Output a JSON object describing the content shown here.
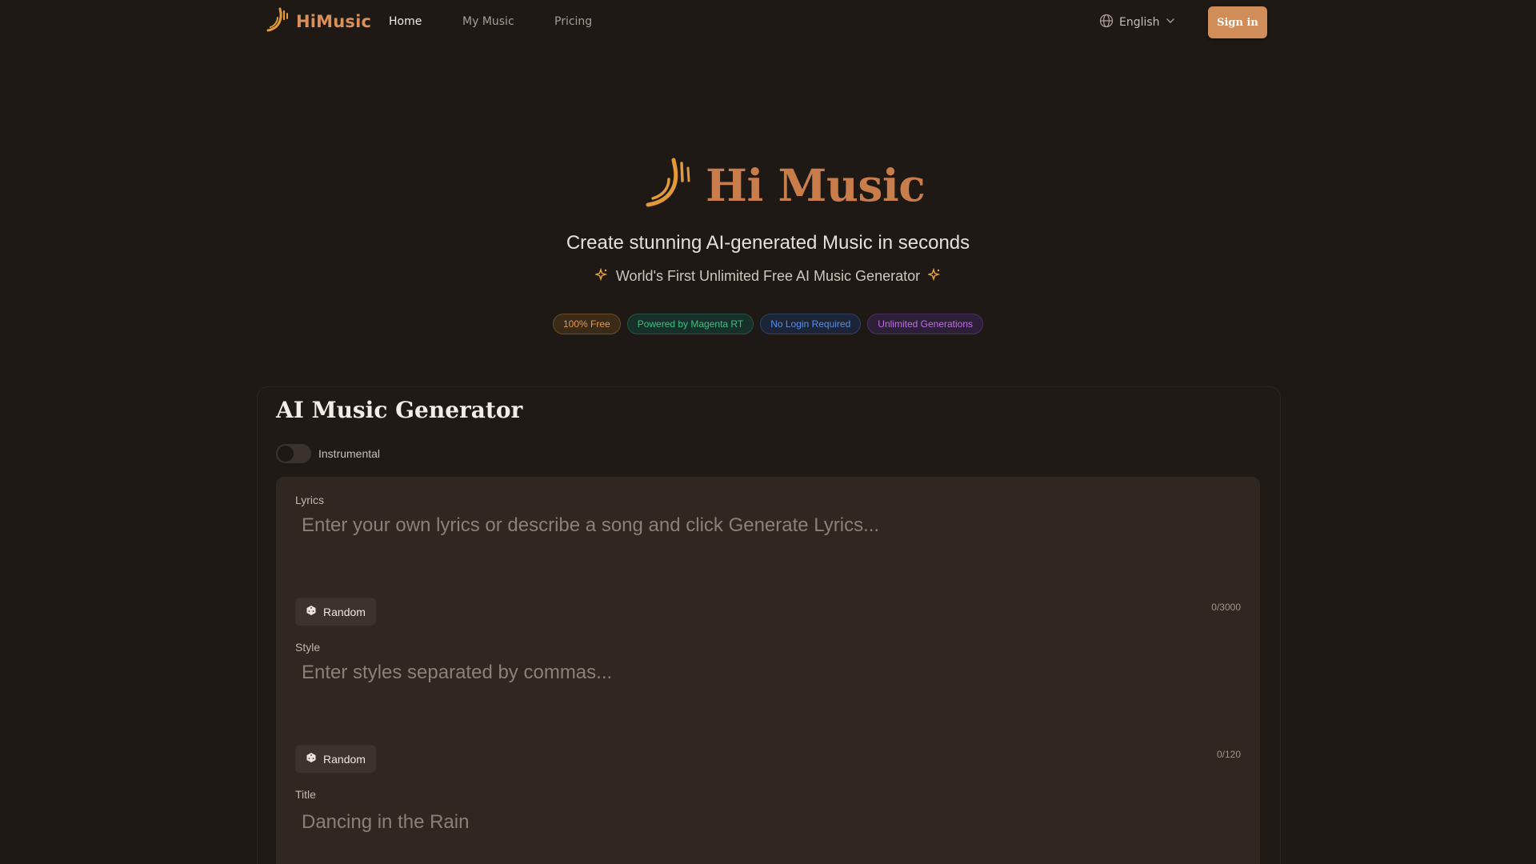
{
  "nav": {
    "brand": "HiMusic",
    "links": [
      {
        "label": "Home",
        "active": true
      },
      {
        "label": "My Music",
        "active": false
      },
      {
        "label": "Pricing",
        "active": false
      }
    ],
    "language": "English",
    "signin_label": "Sign in"
  },
  "hero": {
    "title": "Hi Music",
    "subtitle": "Create stunning AI-generated Music in seconds",
    "tagline": "World's First Unlimited Free AI Music Generator",
    "badges": [
      "100% Free",
      "Powered by Magenta RT",
      "No Login Required",
      "Unlimited Generations"
    ]
  },
  "generator": {
    "title": "AI Music Generator",
    "instrumental_label": "Instrumental",
    "instrumental_on": false,
    "lyrics": {
      "label": "Lyrics",
      "placeholder": "Enter your own lyrics or describe a song and click Generate Lyrics...",
      "random_label": "Random",
      "counter": "0/3000"
    },
    "style": {
      "label": "Style",
      "placeholder": "Enter styles separated by commas...",
      "random_label": "Random",
      "counter": "0/120"
    },
    "title_field": {
      "label": "Title",
      "placeholder": "Dancing in the Rain"
    }
  },
  "colors": {
    "background": "#1f1915",
    "accent": "#d08c59",
    "panel": "#2f2720"
  },
  "icons": [
    "himusic-logo-icon",
    "globe-icon",
    "chevron-down-icon",
    "sparkle-icon",
    "dice-icon"
  ]
}
